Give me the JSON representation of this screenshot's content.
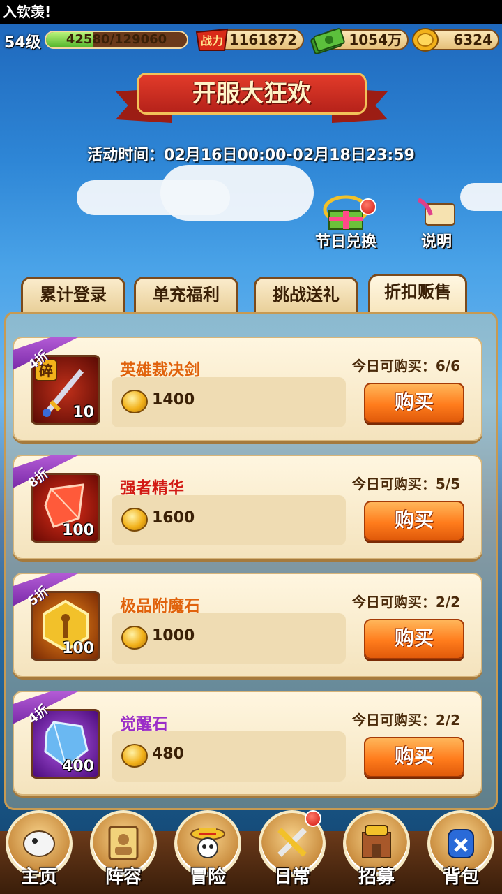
{
  "marquee": {
    "text": "入钦羡!"
  },
  "player": {
    "level": "54级",
    "xp_text": "42580/129060",
    "xp_fraction": 0.33,
    "power_label": "战力",
    "power": "1161872",
    "cash": "1054万",
    "coins": "6324"
  },
  "event": {
    "title": "开服大狂欢",
    "time": "活动时间：02月16日00:00-02月18日23:59"
  },
  "actions": {
    "exchange_label": "节日兑换",
    "help_label": "说明"
  },
  "tabs": [
    {
      "label": "累计登录",
      "active": false
    },
    {
      "label": "单充福利",
      "active": false
    },
    {
      "label": "挑战送礼",
      "active": false
    },
    {
      "label": "折扣贩售",
      "active": true
    }
  ],
  "items": [
    {
      "discount": "4折",
      "name": "英雄裁决剑",
      "name_color": "#e0620c",
      "count": "10",
      "badge": "碎",
      "price": "1400",
      "limit": "今日可购买：6/6",
      "buy_label": "购买",
      "icon": "sword-fragment-icon"
    },
    {
      "discount": "8折",
      "name": "强者精华",
      "name_color": "#d21a14",
      "count": "100",
      "price": "1600",
      "limit": "今日可购买：5/5",
      "buy_label": "购买",
      "icon": "red-crystal-icon"
    },
    {
      "discount": "5折",
      "name": "极品附魔石",
      "name_color": "#e0620c",
      "count": "100",
      "price": "1000",
      "limit": "今日可购买：2/2",
      "buy_label": "购买",
      "icon": "enchant-stone-icon"
    },
    {
      "discount": "4折",
      "name": "觉醒石",
      "name_color": "#9b2dc8",
      "count": "400",
      "price": "480",
      "limit": "今日可购买：2/2",
      "buy_label": "购买",
      "icon": "awaken-gem-icon"
    }
  ],
  "nav": [
    {
      "label": "主页",
      "icon": "home-icon"
    },
    {
      "label": "阵容",
      "icon": "lineup-icon"
    },
    {
      "label": "冒险",
      "icon": "adventure-icon"
    },
    {
      "label": "日常",
      "icon": "daily-icon"
    },
    {
      "label": "招募",
      "icon": "recruit-icon"
    },
    {
      "label": "背包",
      "icon": "backpack-icon"
    }
  ],
  "colors": {
    "accent": "#ff7c1c",
    "panel": "#f4e3bd",
    "discount_badge": "#7a2aa8"
  }
}
